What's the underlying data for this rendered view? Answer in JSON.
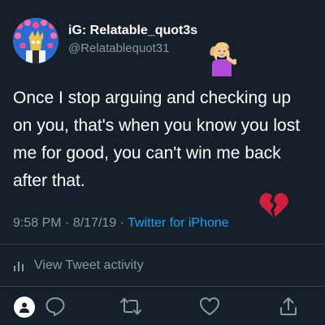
{
  "user": {
    "display_name": "iG: Relatable_quot3s",
    "handle": "@Relatablequot31",
    "header_emoji": "person-tipping-hand-emoji"
  },
  "tweet": {
    "line_1": "Once I stop arguing and checking up",
    "line_2": "on you, that's when you know you lost",
    "line_3": "me for good, you can't win me back",
    "line_4": "after that.",
    "trailing_emoji": "broken-heart-emoji"
  },
  "meta": {
    "time": "9:58 PM",
    "separator": "·",
    "date": "8/17/19",
    "source": "Twitter for iPhone"
  },
  "activity": {
    "label": "View Tweet activity"
  },
  "actions": {
    "icons": [
      "person-icon",
      "reply-icon",
      "retweet-icon",
      "like-icon",
      "share-icon"
    ]
  },
  "colors": {
    "background": "#15202b",
    "secondary_text": "#8899a6",
    "link": "#1da1f2",
    "divider": "#38444d",
    "heart": "#d21f3c"
  }
}
